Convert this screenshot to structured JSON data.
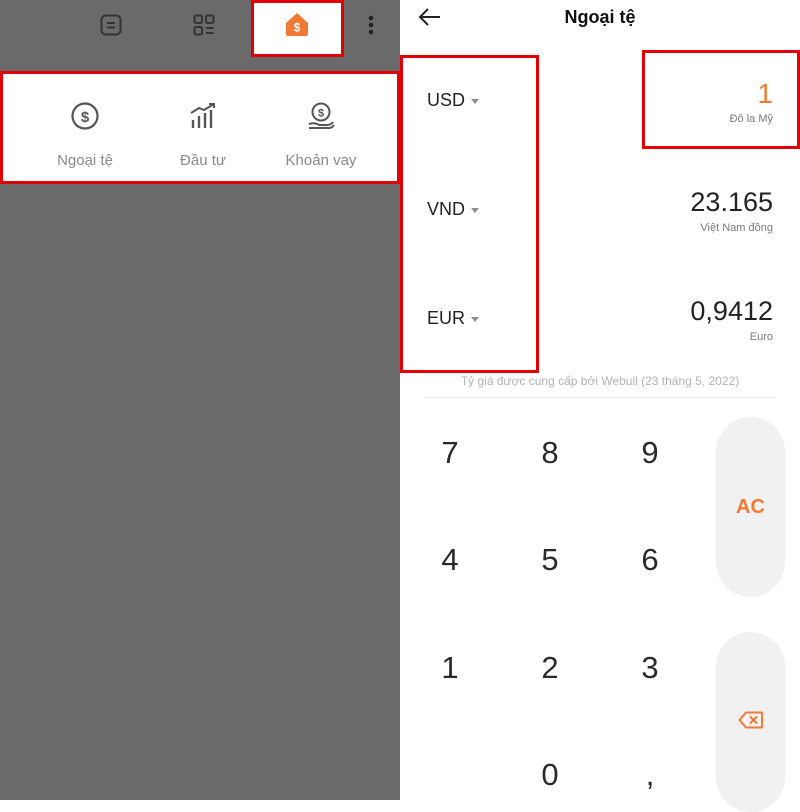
{
  "left_panel": {
    "topbar_icons": [
      "notes-icon",
      "grid-icon",
      "finance-home-icon",
      "more-vertical-icon"
    ],
    "menu": [
      {
        "label": "Ngoại tệ",
        "icon": "dollar-coin-icon"
      },
      {
        "label": "Đầu tư",
        "icon": "bar-chart-up-icon"
      },
      {
        "label": "Khoản vay",
        "icon": "money-hand-icon"
      }
    ]
  },
  "right_panel": {
    "title": "Ngoại tệ",
    "rows": [
      {
        "code": "USD",
        "value": "1",
        "name": "Đô la Mỹ",
        "active": true
      },
      {
        "code": "VND",
        "value": "23.165",
        "name": "Việt Nam đồng",
        "active": false
      },
      {
        "code": "EUR",
        "value": "0,9412",
        "name": "Euro",
        "active": false
      }
    ],
    "provider": "Tỷ giá được cung cấp bởi Webull (23 tháng 5, 2022)",
    "keypad": {
      "row1": [
        "7",
        "8",
        "9"
      ],
      "row2": [
        "4",
        "5",
        "6"
      ],
      "row3": [
        "1",
        "2",
        "3"
      ],
      "row4": [
        "0",
        ","
      ],
      "clear_label": "AC"
    }
  },
  "colors": {
    "accent": "#f07a33",
    "highlight": "#e30000",
    "overlay": "#6a6a6a"
  }
}
